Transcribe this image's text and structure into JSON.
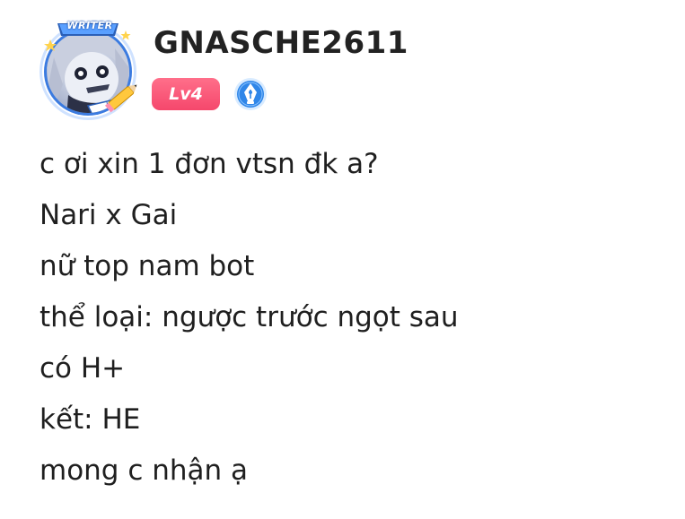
{
  "author": {
    "username": "GNASCHE2611",
    "avatar_badge_text": "WRITER",
    "level_label": "Lv4",
    "icons": {
      "avatar": "avatar-with-writer-frame",
      "level": "level-badge",
      "verified": "fountain-pen-icon"
    }
  },
  "post": {
    "lines": [
      "c ơi xin 1 đơn vtsn đk a?",
      "Nari x Gai",
      "nữ top nam bot",
      "thể loại: ngược trước ngọt sau",
      "có H+",
      "kết: HE",
      "mong c nhận ạ"
    ]
  },
  "colors": {
    "level_badge": "#f5476c",
    "pen_badge": "#2f86e8",
    "frame_blue": "#2a5fb7",
    "text": "#1f1f1f"
  }
}
